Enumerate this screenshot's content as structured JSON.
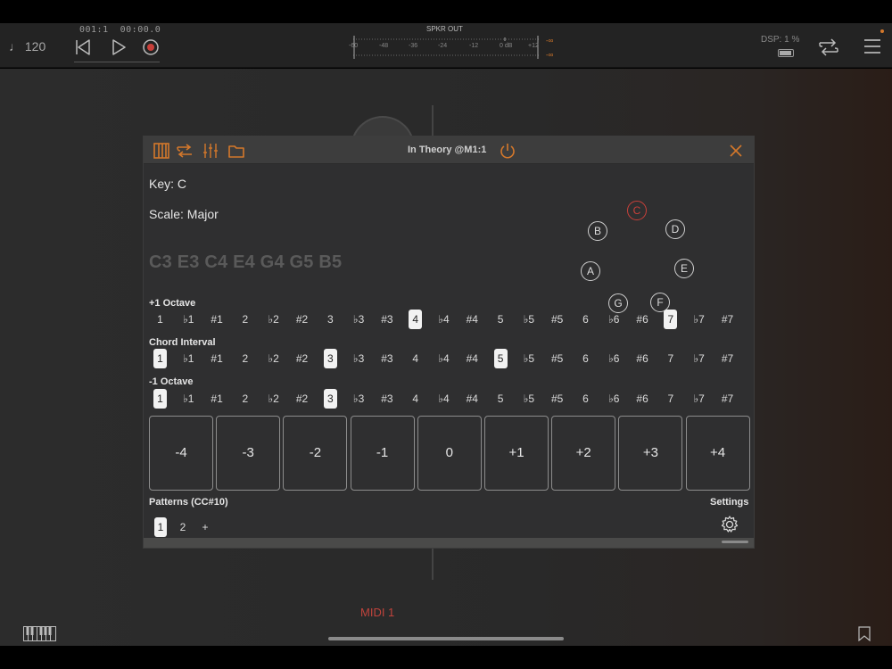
{
  "transport": {
    "tempo": "♩ 120",
    "position": "001:1  00:00.0",
    "meter_title": "SPKR OUT",
    "meter_ticks": [
      "-60",
      "-48",
      "-36",
      "-24",
      "-12",
      "0 dB",
      "+12"
    ],
    "meter_left_value": "-∞",
    "meter_right_value": "-∞",
    "dsp": "DSP:  1 %"
  },
  "plugin": {
    "title": "In Theory @M1:1",
    "key": "Key: C",
    "scale": "Scale: Major",
    "notes": "C3 E3 C4 E4 G4 G5 B5",
    "circle_notes": [
      {
        "label": "C",
        "active": true
      },
      {
        "label": "D",
        "active": false
      },
      {
        "label": "E",
        "active": false
      },
      {
        "label": "F",
        "active": false
      },
      {
        "label": "G",
        "active": false
      },
      {
        "label": "A",
        "active": false
      },
      {
        "label": "B",
        "active": false
      }
    ],
    "rows": [
      {
        "title": "+1 Octave",
        "selected": [
          9,
          18
        ]
      },
      {
        "title": "Chord Interval",
        "selected": [
          0,
          6,
          12
        ]
      },
      {
        "title": "-1 Octave",
        "selected": [
          0,
          6
        ]
      }
    ],
    "intervals": [
      "1",
      "♭1",
      "#1",
      "2",
      "♭2",
      "#2",
      "3",
      "♭3",
      "#3",
      "4",
      "♭4",
      "#4",
      "5",
      "♭5",
      "#5",
      "6",
      "♭6",
      "#6",
      "7",
      "♭7",
      "#7"
    ],
    "pads": [
      "-4",
      "-3",
      "-2",
      "-1",
      "0",
      "+1",
      "+2",
      "+3",
      "+4"
    ],
    "patterns_title": "Patterns (CC#10)",
    "patterns": [
      {
        "label": "1",
        "selected": true
      },
      {
        "label": "2",
        "selected": false
      },
      {
        "label": "+",
        "selected": false
      }
    ],
    "settings_title": "Settings"
  },
  "track": {
    "name": "MIDI 1"
  },
  "colors": {
    "accent": "#d4782b",
    "note_active": "#c9403a",
    "panel": "#2f2f30"
  }
}
